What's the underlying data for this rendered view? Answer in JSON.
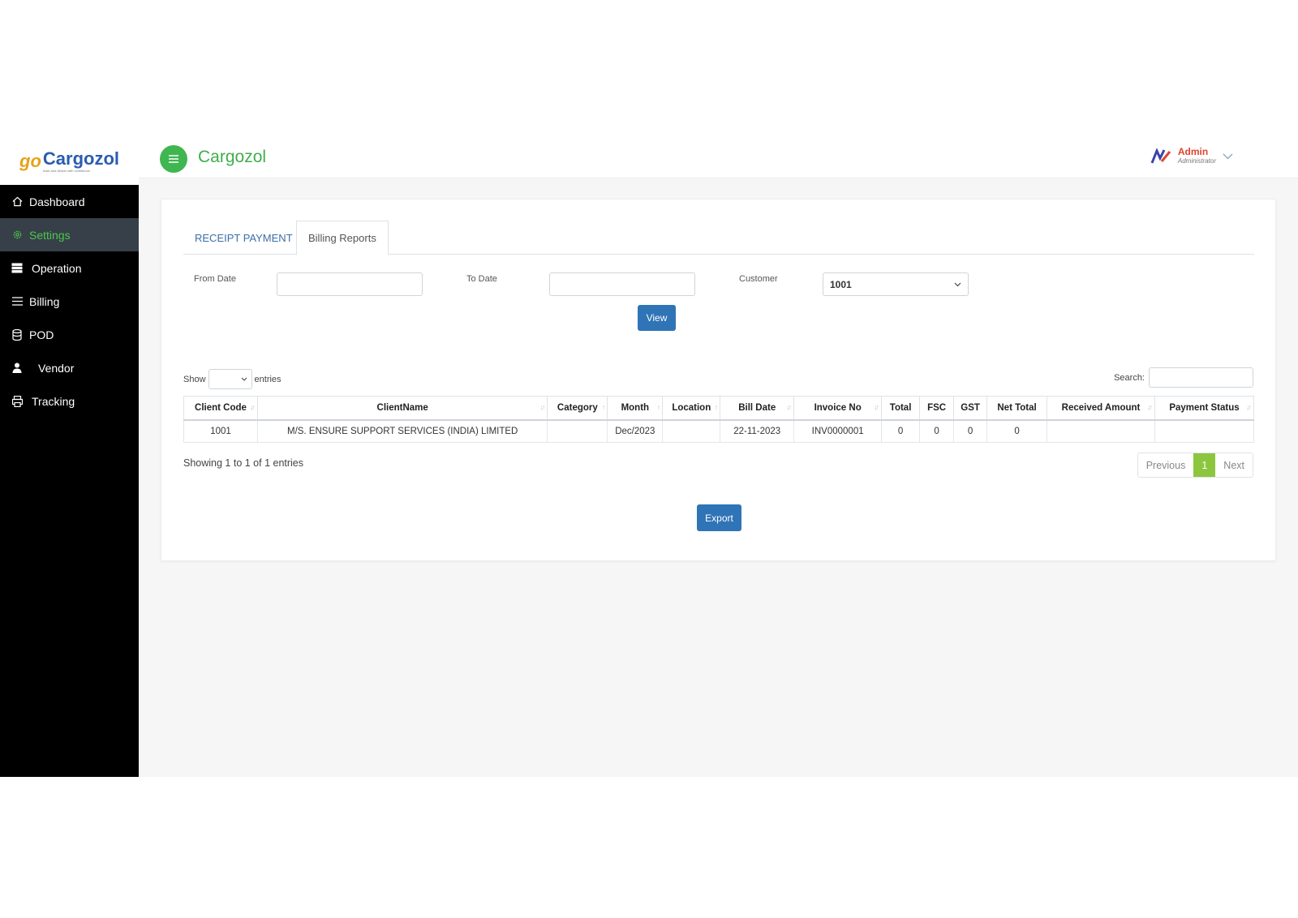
{
  "brand": {
    "logo_mark": "go",
    "logo_text": "Cargozol",
    "logo_tagline": "track and deliver with confidence",
    "app_title": "Cargozol"
  },
  "user": {
    "name": "Admin",
    "role": "Administrator"
  },
  "sidebar": {
    "items": [
      {
        "label": "Dashboard",
        "icon": "home-icon"
      },
      {
        "label": "Settings",
        "icon": "gear-icon"
      },
      {
        "label": "Operation",
        "icon": "server-icon"
      },
      {
        "label": "Billing",
        "icon": "list-icon"
      },
      {
        "label": "POD",
        "icon": "database-icon"
      },
      {
        "label": "Vendor",
        "icon": "user-icon"
      },
      {
        "label": "Tracking",
        "icon": "printer-icon"
      }
    ]
  },
  "tabs": [
    {
      "label": "RECEIPT PAYMENT"
    },
    {
      "label": "Billing Reports"
    }
  ],
  "filters": {
    "from_label": "From Date",
    "from_value": "",
    "to_label": "To Date",
    "to_value": "",
    "customer_label": "Customer",
    "customer_value": "1001",
    "view_label": "View"
  },
  "table": {
    "show_label": "Show",
    "entries_label": "entries",
    "search_label": "Search:",
    "columns": [
      "Client Code",
      "ClientName",
      "Category",
      "Month",
      "Location",
      "Bill Date",
      "Invoice No",
      "Total",
      "FSC",
      "GST",
      "Net Total",
      "Received Amount",
      "Payment Status"
    ],
    "rows": [
      [
        "1001",
        "M/S. ENSURE SUPPORT SERVICES (INDIA) LIMITED",
        "",
        "Dec/2023",
        "",
        "22-11-2023",
        "INV0000001",
        "0",
        "0",
        "0",
        "0",
        "",
        ""
      ]
    ],
    "info": "Showing 1 to 1 of 1 entries",
    "pager": {
      "prev": "Previous",
      "current": "1",
      "next": "Next"
    }
  },
  "export_label": "Export",
  "colors": {
    "green": "#3fb650",
    "blue": "#2f74b6",
    "sidebar": "#000000",
    "active_item": "#373f49"
  }
}
